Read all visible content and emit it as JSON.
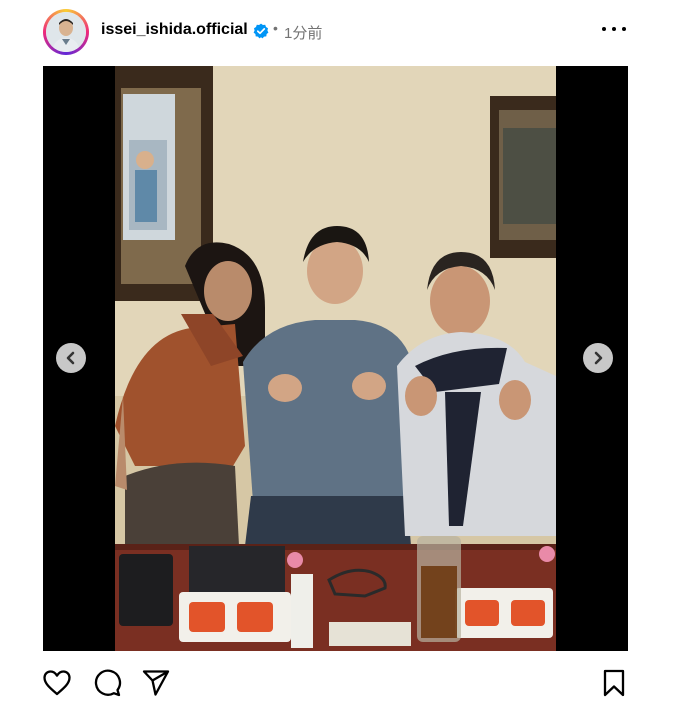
{
  "post": {
    "username": "issei_ishida.official",
    "separator": "•",
    "time": "1分前"
  },
  "icons": {
    "verified": "verified-badge-icon",
    "more": "more-options-icon",
    "prev": "chevron-left-icon",
    "next": "chevron-right-icon",
    "like": "heart-icon",
    "comment": "comment-icon",
    "share": "send-icon",
    "save": "bookmark-icon"
  },
  "colors": {
    "verified": "#0095f6",
    "secondary_text": "#737373"
  }
}
